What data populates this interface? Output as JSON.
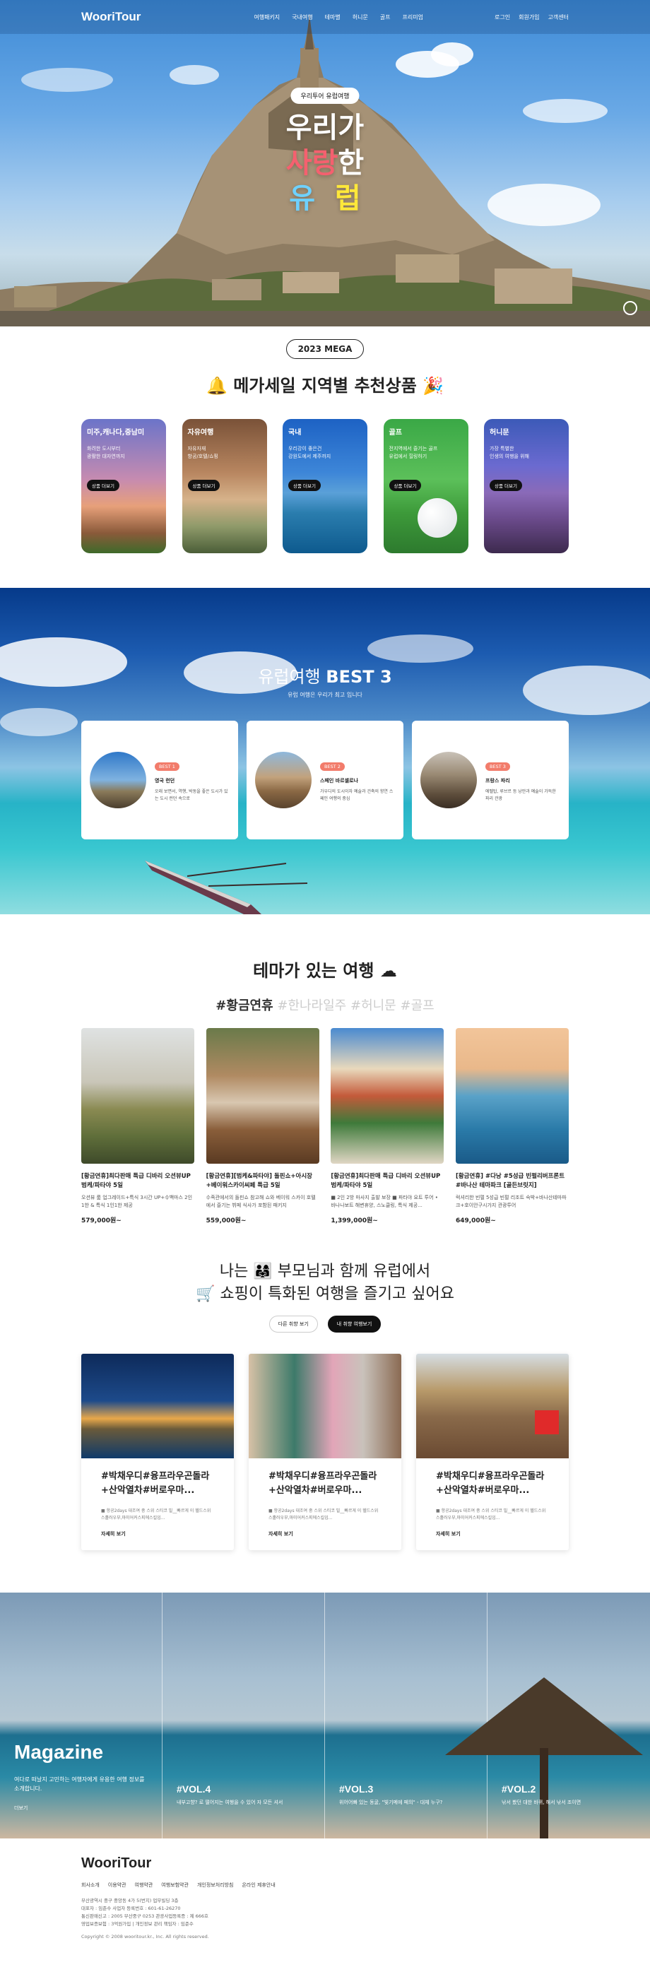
{
  "header": {
    "logo": "WooriTour",
    "nav": [
      "여행패키지",
      "국내여행",
      "테마별",
      "허니문",
      "골프",
      "프리미엄"
    ],
    "util": [
      "로그인",
      "회원가입",
      "고객센터"
    ]
  },
  "hero": {
    "badge": "우리투어 유럽여행",
    "line1": "우리가",
    "line2a": "사랑",
    "line2b": "한",
    "line3a": "유",
    "line3b": "럽"
  },
  "mega": {
    "pill": "2023 MEGA",
    "title": "메가세일 지역별 추천상품",
    "cards": [
      {
        "title": "미주,캐나다,중남미",
        "desc1": "화려한 도시부터",
        "desc2": "광활한 대자연까지",
        "btn": "상품 더보기"
      },
      {
        "title": "자유여행",
        "desc1": "자유자재",
        "desc2": "항공/호텔/쇼핑",
        "btn": "상품 더보기"
      },
      {
        "title": "국내",
        "desc1": "우리강이 좋은건",
        "desc2": "강원도에서 제주까지",
        "btn": "상품 더보기"
      },
      {
        "title": "골프",
        "desc1": "전지역에서 즐기는 골프",
        "desc2": "유럽에서 힐링하기",
        "btn": "상품 더보기"
      },
      {
        "title": "허니문",
        "desc1": "가장 특별한",
        "desc2": "인생의 여행을 위해",
        "btn": "상품 더보기"
      }
    ]
  },
  "best": {
    "title_a": "유럽여행",
    "title_b": "BEST 3",
    "sub": "유럽 여행은 우리가 최고 입니다",
    "cards": [
      {
        "tag": "BEST 1",
        "name": "영국 런던",
        "desc": "오래 보면서, 역행, 박동을 좋은 도시가 있는 도시 런던 속으로"
      },
      {
        "tag": "BEST 2",
        "name": "스페인 바르셀로나",
        "desc": "가우디의 도시이자 예술과 건축의 향연 스페인 여행의 중심"
      },
      {
        "tag": "BEST 3",
        "name": "프랑스 파리",
        "desc": "에펠탑, 루브르 등 낭만과 예술이 가득한 파리 관광"
      }
    ]
  },
  "theme": {
    "title": "테마가 있는 여행",
    "tags": [
      "#황금연휴",
      "#한나라일주",
      "#허니문",
      "#골프"
    ],
    "cards": [
      {
        "title": "[황금연휴]최다판매 특급 디바리 오션뷰UP 범케/파타야 5일",
        "desc": "오션뷰 룸 업그레이드+특식 3시간 UP+수백마스 2인1한 & 특식 1인1한 제공",
        "price": "579,000원~"
      },
      {
        "title": "[황금연휴][범케&파타야] 돌핀쇼+아시장+베이워스카이씨페 특급 5일",
        "desc": "수족관에서의 돌핀쇼 참고해 쇼와 베이워 스카이 호텔에서 즐기는 뷔페 식사가 포함된 패키지",
        "price": "559,000원~"
      },
      {
        "title": "[황금연휴]최다판매 특급 디바리 오션뷰UP 범케/파타야 5일",
        "desc": "■ 2인 2방 마사지 출발 보장 ■ 파타야 요트 투어 • 바나나보트 해변휴양, 스노클링, 특식 제공...",
        "price": "1,399,000원~"
      },
      {
        "title": "[황금연휴] #다낭 #5성급 빈펄리버프론트 #바나산 테마파크 [골든브릿지]",
        "desc": "럭셔리한 빈펄 5성급 빈펄 리조트 숙박+바나산테마파크+호이안구시가지 관광투어",
        "price": "649,000원~"
      }
    ]
  },
  "parents": {
    "line1a": "나는",
    "line1b": "부모님과 함께 유럽에서",
    "line2": "쇼핑이 특화된 여행을 즐기고 싶어요",
    "btn_off": "다른 취향 보기",
    "btn_on": "내 취향 여행보기",
    "cards": [
      {
        "title": "#박채우디#융프라우곤돌라+산악열차#버로우마...",
        "desc": "■ 항공2days 대조여 중 스위 스티코 빌__빠르게 이 헬드스위스홀러우부,마미어커스피에스킬입...",
        "more": "자세히 보기"
      },
      {
        "title": "#박채우디#융프라우곤돌라+산악열차#버로우마...",
        "desc": "■ 항공2days 대조여 중 스위 스티코 빌__빠르게 이 헬드스위스홀러우부,마미어커스피에스킬입...",
        "more": "자세히 보기"
      },
      {
        "title": "#박채우디#융프라우곤돌라+산악열차#버로우마...",
        "desc": "■ 항공2days 대조여 중 스위 스티코 빌__빠르게 이 헬드스위스홀러우부,마미어커스피에스킬입...",
        "more": "자세히 보기"
      }
    ]
  },
  "magazine": {
    "title": "Magazine",
    "desc": "여다로 떠날지 고민하는 여행자에게 유용한 여행 정보를 소개합니다.",
    "more": "더보기",
    "vols": [
      {
        "vol": "#VOL.4",
        "desc": "내부고향? 로 떨어지는 여행을 수 있어 자 모든 셔서"
      },
      {
        "vol": "#VOL.3",
        "desc": "위어어빠 있는 동굴, \"빛기메에 페의\" - 대체 누구?"
      },
      {
        "vol": "#VOL.2",
        "desc": "낚서 봤던 대한 바뀌, 해서 낚서 조이면"
      }
    ]
  },
  "footer": {
    "logo": "WooriTour",
    "links": [
      "회사소개",
      "이용약관",
      "여행약관",
      "여행보험약관",
      "개인정보처리방침",
      "온라인 제휴안내"
    ],
    "info1": "부산광역시 중구 중앙동 4가 5(번지) 업무빌딩 3층",
    "info2": "대표자 : 임준수 사업자 등록번호 : 601-61-26270",
    "info3": "통신판매신고 : 2005 부산중구 0253 관광사업등록증 : 제 666호",
    "info4": "영업보증보험 : 3억원가입 | 개인정보 관리 책임자 : 임준수",
    "copy": "Copyright © 2008 wooritour.kr., Inc. All rights reserved."
  }
}
